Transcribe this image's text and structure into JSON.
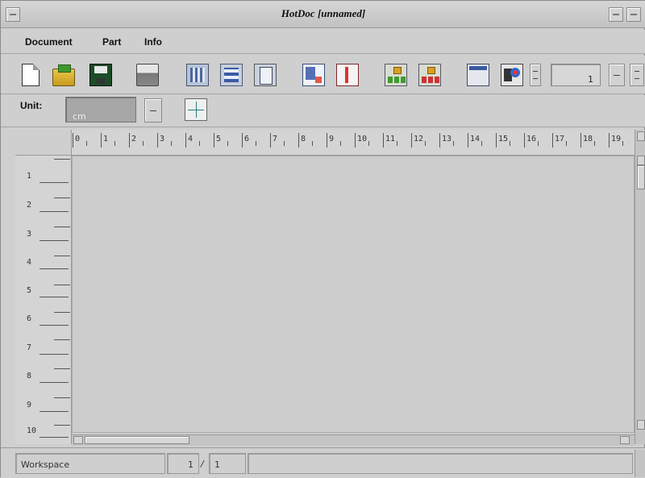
{
  "window": {
    "title": "HotDoc  [unnamed]"
  },
  "menubar": {
    "items": [
      "Document",
      "Part",
      "Info"
    ]
  },
  "toolbar": {
    "tools": [
      {
        "name": "new-document-icon"
      },
      {
        "name": "open-folder-icon"
      },
      {
        "name": "save-disk-icon"
      },
      {
        "name": "print-icon"
      },
      {
        "name": "cut-icon"
      },
      {
        "name": "copy-icon"
      },
      {
        "name": "paste-icon"
      },
      {
        "name": "insert-part-icon"
      },
      {
        "name": "delete-part-icon"
      },
      {
        "name": "hierarchy-icon"
      },
      {
        "name": "hierarchy-remove-icon"
      },
      {
        "name": "window-icon"
      },
      {
        "name": "properties-icon"
      }
    ],
    "page_value": "1"
  },
  "unit": {
    "label": "Unit:",
    "value": "cm"
  },
  "ruler": {
    "horizontal_ticks": [
      "0",
      "1",
      "2",
      "3",
      "4",
      "5",
      "6",
      "7",
      "8",
      "9",
      "10",
      "11",
      "12",
      "13",
      "14",
      "15",
      "16",
      "17",
      "18",
      "19"
    ],
    "vertical_ticks": [
      "1",
      "2",
      "3",
      "4",
      "5",
      "6",
      "7",
      "8",
      "9",
      "10"
    ]
  },
  "statusbar": {
    "workspace": "Workspace",
    "page_current": "1",
    "separator": "/",
    "page_total": "1"
  }
}
